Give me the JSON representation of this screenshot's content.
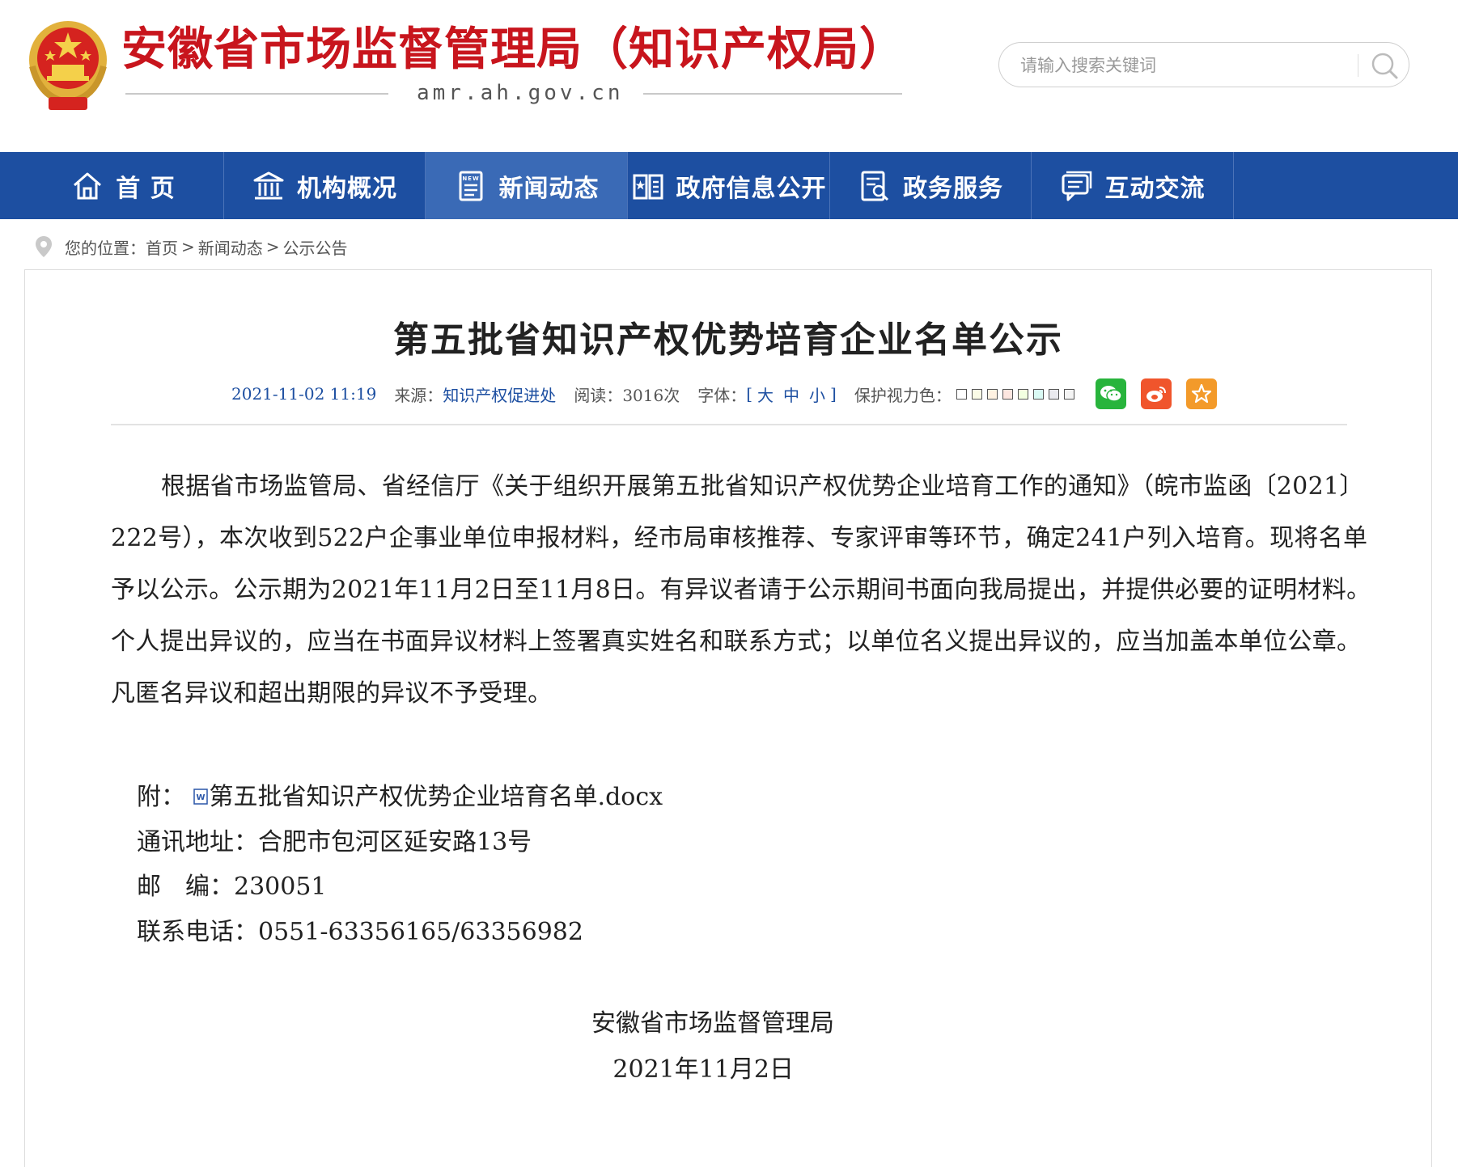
{
  "header": {
    "site_title": "安徽省市场监督管理局（知识产权局）",
    "domain": "amr.ah.gov.cn",
    "search_placeholder": "请输入搜索关键词"
  },
  "nav": {
    "items": [
      {
        "label": "首 页",
        "icon": "home-icon"
      },
      {
        "label": "机构概况",
        "icon": "building-icon"
      },
      {
        "label": "新闻动态",
        "icon": "news-icon",
        "active": true
      },
      {
        "label": "政府信息公开",
        "icon": "book-icon"
      },
      {
        "label": "政务服务",
        "icon": "document-icon"
      },
      {
        "label": "互动交流",
        "icon": "chat-icon"
      }
    ]
  },
  "breadcrumb": {
    "prefix": "您的位置：",
    "home": "首页",
    "separator": ">",
    "section": "新闻动态",
    "current": "公示公告"
  },
  "article": {
    "title": "第五批省知识产权优势培育企业名单公示",
    "date": "2021-11-02 11:19",
    "source_label": "来源：",
    "source": "知识产权促进处",
    "views_label": "阅读：",
    "views": "3016次",
    "font_label": "字体：",
    "font_open": "[",
    "font_large": "大",
    "font_medium": "中",
    "font_small": "小",
    "font_close": "]",
    "eye_label": "保护视力色：",
    "eye_colors": [
      "#ffffff",
      "#fafbe6",
      "#fff2e2",
      "#fde6e0",
      "#f3ffe1",
      "#dafaf4",
      "#eaeaef",
      "#f4f4f4"
    ],
    "share": [
      {
        "name": "wechat-share",
        "color": "#28b43c"
      },
      {
        "name": "weibo-share",
        "color": "#f0552c"
      },
      {
        "name": "favorite-share",
        "color": "#f39a2a"
      }
    ],
    "body": "根据省市场监管局、省经信厅《关于组织开展第五批省知识产权优势企业培育工作的通知》（皖市监函〔2021〕222号），本次收到522户企事业单位申报材料，经市局审核推荐、专家评审等环节，确定241户列入培育。现将名单予以公示。公示期为2021年11月2日至11月8日。有异议者请于公示期间书面向我局提出，并提供必要的证明材料。个人提出异议的，应当在书面异议材料上签署真实姓名和联系方式；以单位名义提出异议的，应当加盖本单位公章。凡匿名异议和超出期限的异议不予受理。",
    "attachment_label": "附：",
    "attachment_name": "第五批省知识产权优势企业培育名单.docx",
    "address": "通讯地址：合肥市包河区延安路13号",
    "postcode": "邮　编：230051",
    "phone": "联系电话：0551-63356165/63356982",
    "signature_org": "安徽省市场监督管理局",
    "signature_date": "2021年11月2日"
  }
}
